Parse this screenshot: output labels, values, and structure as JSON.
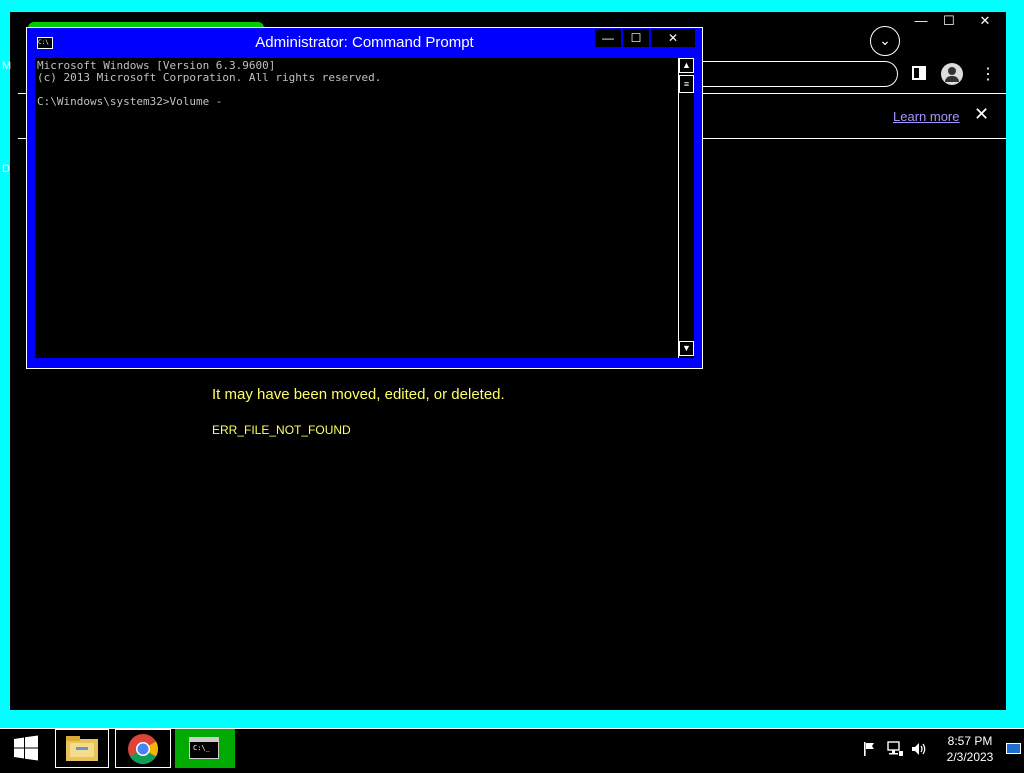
{
  "browser": {
    "window_controls": {
      "minimize": "—",
      "maximize": "☐",
      "close": "✕"
    },
    "dropdown_icon": "⌄",
    "info_bar": {
      "link": "Learn more",
      "close": "✕"
    },
    "left_edge_letters": [
      "M",
      "D"
    ],
    "error": {
      "message": "It may have been moved, edited, or deleted.",
      "code": "ERR_FILE_NOT_FOUND"
    }
  },
  "cmd": {
    "title": "Administrator:  Command Prompt",
    "icon_text": "C:\\",
    "window_controls": {
      "minimize": "—",
      "maximize": "☐",
      "close": "✕"
    },
    "lines": [
      "Microsoft Windows [Version 6.3.9600]",
      "(c) 2013 Microsoft Corporation. All rights reserved.",
      "",
      "C:\\Windows\\system32>Volume -"
    ]
  },
  "taskbar": {
    "clock_time": "8:57 PM",
    "clock_date": "2/3/2023"
  },
  "colors": {
    "window_frame": "#00ffff",
    "cmd_frame": "#0000ff",
    "error_text": "#ffff66",
    "link": "#a894ff",
    "active_task": "#00aa00"
  }
}
